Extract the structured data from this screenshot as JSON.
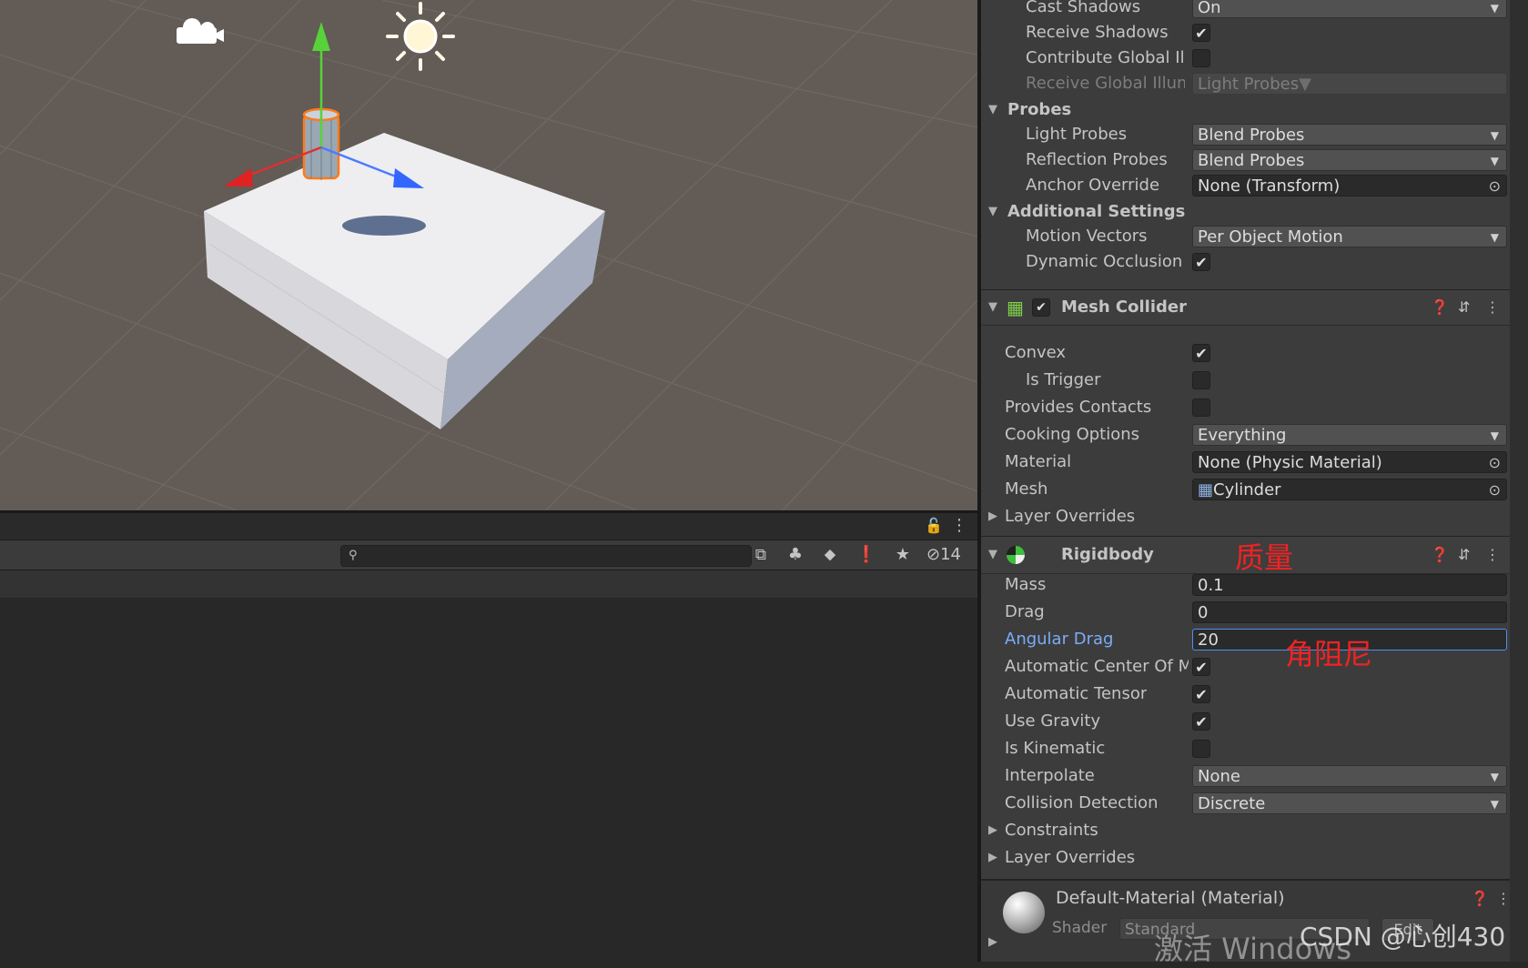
{
  "scene_view": {
    "object_count": "14"
  },
  "inspector": {
    "mesh_renderer_rows": [
      {
        "label": "Cast Shadows",
        "type": "dropdown",
        "value": "On"
      },
      {
        "label": "Receive Shadows",
        "type": "checkbox",
        "checked": true
      },
      {
        "label": "Contribute Global Illu",
        "type": "checkbox",
        "checked": false
      },
      {
        "label": "Receive Global Illum",
        "type": "dropdown-disabled",
        "value": "Light Probes"
      }
    ],
    "probes": {
      "title": "Probes",
      "rows": [
        {
          "label": "Light Probes",
          "value": "Blend Probes"
        },
        {
          "label": "Reflection Probes",
          "value": "Blend Probes"
        },
        {
          "label": "Anchor Override",
          "value": "None (Transform)"
        }
      ]
    },
    "additional": {
      "title": "Additional Settings",
      "rows": [
        {
          "label": "Motion Vectors",
          "value": "Per Object Motion"
        },
        {
          "label": "Dynamic Occlusion",
          "checked": true
        }
      ]
    },
    "mesh_collider": {
      "title": "Mesh Collider",
      "rows": {
        "convex": "Convex",
        "is_trigger": "Is Trigger",
        "provides_contacts": "Provides Contacts",
        "cooking_options": "Cooking Options",
        "cooking_value": "Everything",
        "material": "Material",
        "material_value": "None (Physic Material)",
        "mesh": "Mesh",
        "mesh_value": "Cylinder",
        "layer_overrides": "Layer Overrides"
      },
      "checks": {
        "convex": true,
        "is_trigger": false,
        "provides_contacts": false
      }
    },
    "rigidbody": {
      "title": "Rigidbody",
      "mass_label": "Mass",
      "mass": "0.1",
      "drag_label": "Drag",
      "drag": "0",
      "angular_drag_label": "Angular Drag",
      "angular_drag": "20",
      "auto_com": "Automatic Center Of M",
      "auto_tensor": "Automatic Tensor",
      "use_gravity": "Use Gravity",
      "is_kinematic": "Is Kinematic",
      "interpolate_label": "Interpolate",
      "interpolate": "None",
      "collision_label": "Collision Detection",
      "collision": "Discrete",
      "constraints": "Constraints",
      "layer_overrides": "Layer Overrides"
    },
    "material": {
      "name": "Default-Material (Material)",
      "shader_label": "Shader",
      "shader_value": "Standard",
      "edit_label": "Edit"
    }
  },
  "annotations": {
    "mass_note": "质量",
    "angular_note": "角阻尼"
  },
  "watermarks": {
    "csdn": "CSDN @心创430",
    "windows": "激活 Windows"
  },
  "colors": {
    "scene_bg": "#625b56",
    "panel_bg": "#3c3c3c",
    "accent_blue": "#7cacf8",
    "annotation_red": "#f22222"
  }
}
